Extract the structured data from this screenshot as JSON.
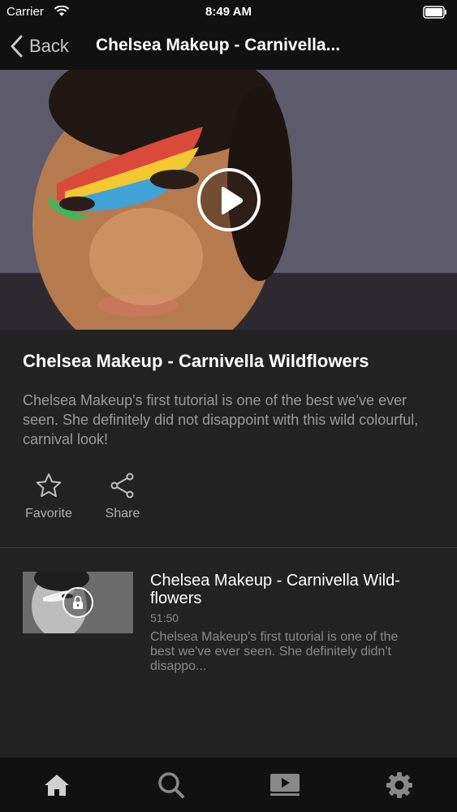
{
  "status_bar": {
    "carrier": "Carrier",
    "time": "8:49 AM"
  },
  "nav": {
    "back_label": "Back",
    "title": "Chelsea Makeup - Carnivella..."
  },
  "video": {
    "title": "Chelsea Makeup - Carnivella Wildflowers",
    "description": "Chelsea Makeup's first tutorial is one of the best we've ever seen. She definitely did not disappoint with this wild colourful, carnival look!"
  },
  "actions": {
    "favorite_label": "Favorite",
    "share_label": "Share"
  },
  "episodes": [
    {
      "title": "Chelsea Makeup - Carnivella Wild-flowers",
      "duration": "51:50",
      "description": "Chelsea Makeup's first tutorial is one of the best we've ever seen. She definitely didn't disappo...",
      "locked": true
    }
  ],
  "tab_bar": {
    "items": [
      {
        "icon": "home-icon"
      },
      {
        "icon": "search-icon"
      },
      {
        "icon": "video-library-icon"
      },
      {
        "icon": "gear-icon"
      }
    ]
  },
  "colors": {
    "background": "#222222",
    "bars": "#111111",
    "muted_text": "#9a9a9a"
  }
}
